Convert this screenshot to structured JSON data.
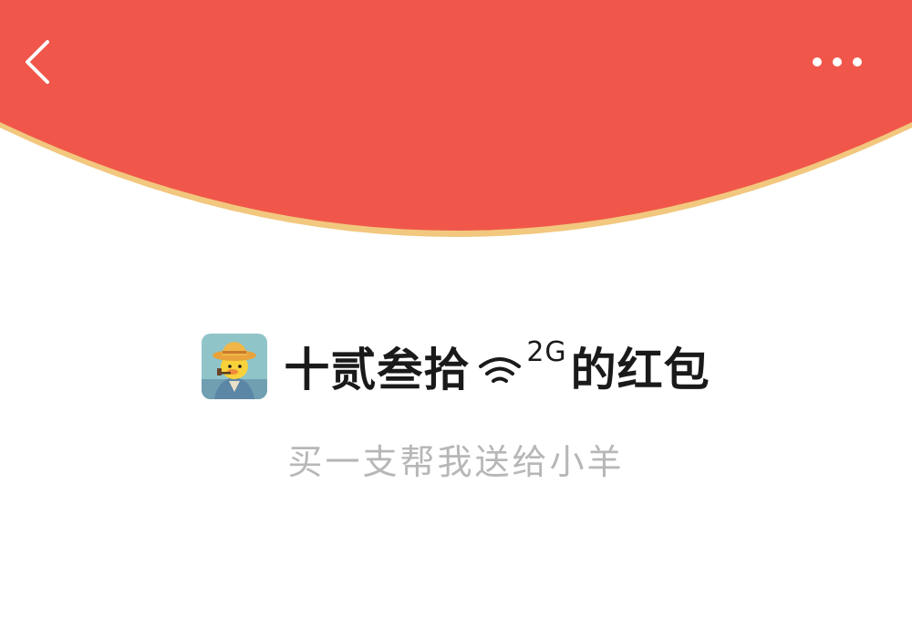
{
  "header": {
    "background_color": "#F0574A",
    "rim_color": "#F2C77E",
    "back_icon": "chevron-left-icon",
    "more_icon": "more-horizontal-icon"
  },
  "envelope": {
    "sender_avatar": "duck-avatar",
    "title_part1": "十贰叁拾",
    "title_sup": "2G",
    "title_part2": "的红包",
    "subtitle": "买一支帮我送给小羊"
  }
}
